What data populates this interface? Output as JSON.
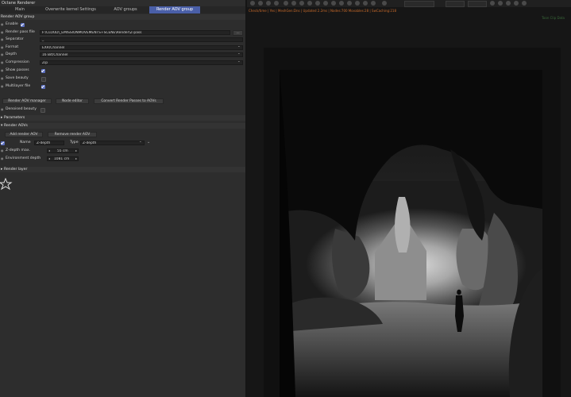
{
  "window": {
    "title": "Octane Renderer"
  },
  "tabs": [
    {
      "label": "Main"
    },
    {
      "label": "Overwrite kernel Settings"
    },
    {
      "label": "AOV groups"
    },
    {
      "label": "Render AOV group"
    }
  ],
  "aov_group": {
    "header": "Render AOV group",
    "enable_label": "Enable",
    "render_pass_file_label": "Render pass file",
    "render_pass_file_value": "F:\\CLOUD\\_EMISSIONMOVEMENTS+SCENE\\Render\\Z-pass",
    "browse_label": "...",
    "separator_label": "Separator",
    "separator_value": "_",
    "format_label": "Format",
    "format_value": "EXR/Channel",
    "depth_label": "Depth",
    "depth_value": "16 Bit/Channel",
    "compression_label": "Compression",
    "compression_value": "Zip",
    "show_passes_label": "Show passes",
    "save_beauty_label": "Save beauty",
    "multilayer_label": "Multilayer file",
    "btn_manager": "Render AOV manager",
    "btn_node_editor": "Node editor",
    "btn_convert": "Convert Render Passes to AOVs",
    "denoised_label": "Denoised beauty"
  },
  "parameters": {
    "header": "Parameters"
  },
  "render_aovs": {
    "header": "Render AOVs",
    "add_label": "Add render AOV",
    "remove_label": "Remove render AOV",
    "name_label": "Name",
    "name_value": "Z-depth",
    "type_label": "Type",
    "type_value": "Z-depth",
    "zmax_label": "Z-depth max.",
    "zmax_value": "55 cm",
    "env_label": "Environment depth",
    "env_value": "1081 cm"
  },
  "render_layer": {
    "header": "Render layer"
  },
  "viewer": {
    "status_text": "Check/time | Yes | MeshGen:Dns | Updated 2.2ms | Nodes:700 Movables:28 | SwCaching:218",
    "side_label": "Toon Clip Data"
  }
}
